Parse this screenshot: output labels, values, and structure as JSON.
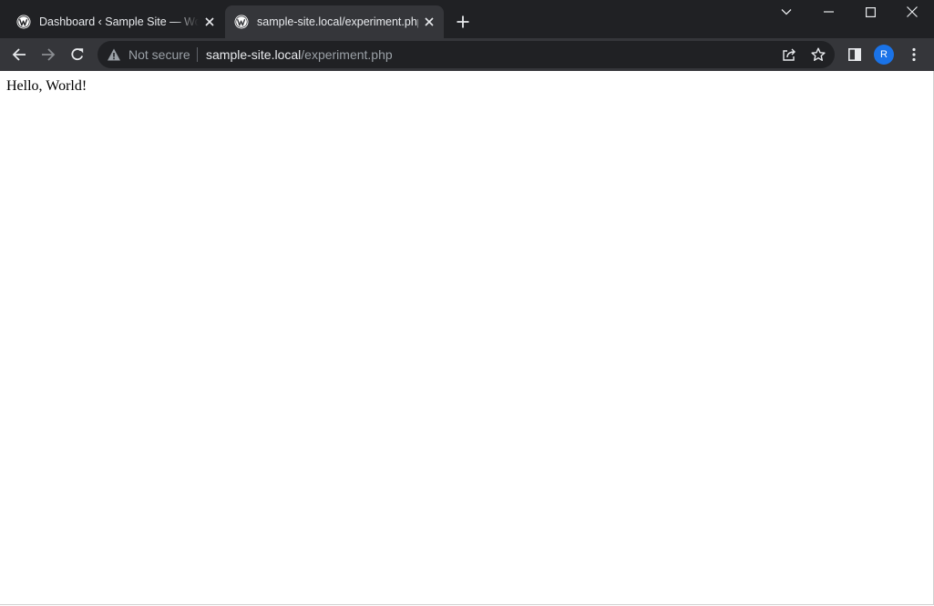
{
  "tabs": [
    {
      "title": "Dashboard ‹ Sample Site — WordPress",
      "favicon": "wordpress-icon",
      "active": false
    },
    {
      "title": "sample-site.local/experiment.php",
      "favicon": "wordpress-icon",
      "active": true
    }
  ],
  "address_bar": {
    "security_label": "Not secure",
    "security_icon": "warning-icon",
    "host": "sample-site.local",
    "path": "/experiment.php"
  },
  "profile": {
    "initial": "R",
    "color": "#1a73e8"
  },
  "page": {
    "text": "Hello, World!"
  },
  "colors": {
    "tabstrip": "#202124",
    "toolbar": "#35363a",
    "omnibox": "#202124"
  }
}
